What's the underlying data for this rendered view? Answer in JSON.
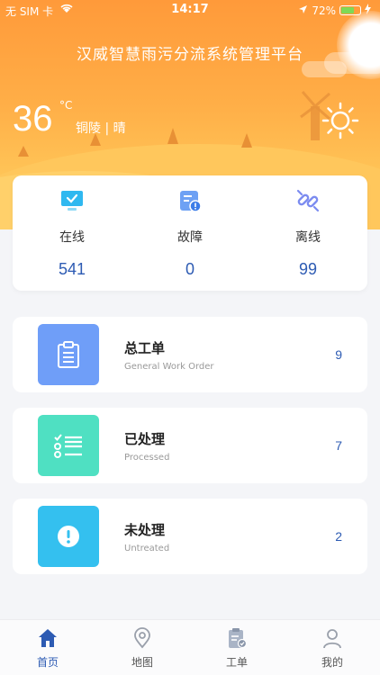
{
  "status_bar": {
    "carrier": "无 SIM 卡",
    "time": "14:17",
    "battery": "72%",
    "battery_level": 0.72
  },
  "header": {
    "title": "汉威智慧雨污分流系统管理平台"
  },
  "weather": {
    "temperature": "36",
    "unit": "°C",
    "location": "铜陵 | 晴",
    "icon": "sun-icon"
  },
  "stats": [
    {
      "label": "在线",
      "value": "541",
      "icon": "monitor-icon"
    },
    {
      "label": "故障",
      "value": "0",
      "icon": "fault-icon"
    },
    {
      "label": "离线",
      "value": "99",
      "icon": "offline-icon"
    }
  ],
  "work_orders": [
    {
      "title": "总工单",
      "subtitle": "General Work Order",
      "count": "9",
      "color": "#6f9ef8",
      "icon": "clipboard-icon"
    },
    {
      "title": "已处理",
      "subtitle": "Processed",
      "count": "7",
      "color": "#4fe0c2",
      "icon": "checklist-icon"
    },
    {
      "title": "未处理",
      "subtitle": "Untreated",
      "count": "2",
      "color": "#34c0ef",
      "icon": "alert-icon"
    }
  ],
  "tabs": [
    {
      "label": "首页",
      "icon": "home-icon",
      "active": true
    },
    {
      "label": "地图",
      "icon": "map-pin-icon",
      "active": false
    },
    {
      "label": "工单",
      "icon": "order-icon",
      "active": false
    },
    {
      "label": "我的",
      "icon": "user-icon",
      "active": false
    }
  ],
  "colors": {
    "accent": "#2d5bb3",
    "header_orange": "#ff9a3a"
  }
}
